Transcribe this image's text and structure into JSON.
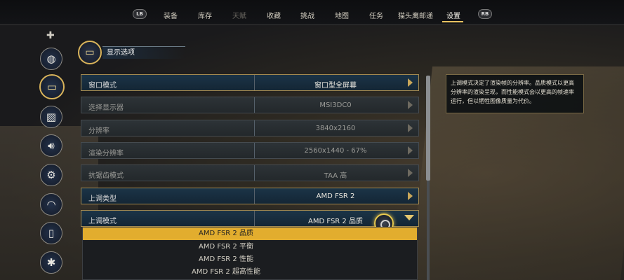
{
  "nav": {
    "lb": "LB",
    "rb": "RB",
    "items": [
      {
        "label": "装备",
        "state": "normal"
      },
      {
        "label": "库存",
        "state": "normal"
      },
      {
        "label": "天赋",
        "state": "dim"
      },
      {
        "label": "收藏",
        "state": "normal"
      },
      {
        "label": "挑战",
        "state": "normal"
      },
      {
        "label": "地图",
        "state": "normal"
      },
      {
        "label": "任务",
        "state": "normal"
      },
      {
        "label": "猫头鹰邮递",
        "state": "normal"
      },
      {
        "label": "设置",
        "state": "active"
      }
    ]
  },
  "sidebar": {
    "items": [
      {
        "icon": "disc-icon"
      },
      {
        "icon": "display-icon",
        "active": true
      },
      {
        "icon": "graphics-icon"
      },
      {
        "icon": "speaker-icon"
      },
      {
        "icon": "gear-icon"
      },
      {
        "icon": "gamepad-icon"
      },
      {
        "icon": "mouse-icon"
      },
      {
        "icon": "accessibility-icon"
      }
    ]
  },
  "section": {
    "title": "显示选项",
    "icon": "monitor-icon"
  },
  "rows": [
    {
      "label": "窗口模式",
      "value": "窗口型全屏幕",
      "state": "highlight"
    },
    {
      "label": "选择显示器",
      "value": "MSI3DC0",
      "state": "disabled"
    },
    {
      "label": "分辨率",
      "value": "3840x2160",
      "state": "disabled"
    },
    {
      "label": "渲染分辨率",
      "value": "2560x1440 - 67%",
      "state": "disabled"
    },
    {
      "label": "抗锯齿模式",
      "value": "TAA 高",
      "state": "disabled"
    },
    {
      "label": "上调类型",
      "value": "AMD FSR 2",
      "state": "highlight"
    },
    {
      "label": "上调模式",
      "value": "AMD FSR 2 品质",
      "state": "open"
    }
  ],
  "dropdown": {
    "options": [
      "AMD FSR 2 品质",
      "AMD FSR 2 平衡",
      "AMD FSR 2 性能",
      "AMD FSR 2 超高性能"
    ],
    "selected_index": 0
  },
  "tooltip": {
    "text": "上调模式决定了渲染帧的分辨率。品质模式以更高分辨率的渲染呈现，而性能模式会以更高的帧速率运行，但以牺牲图像质量为代价。"
  },
  "colors": {
    "accent": "#e2ad2e",
    "gold_border": "#d9b45b"
  }
}
